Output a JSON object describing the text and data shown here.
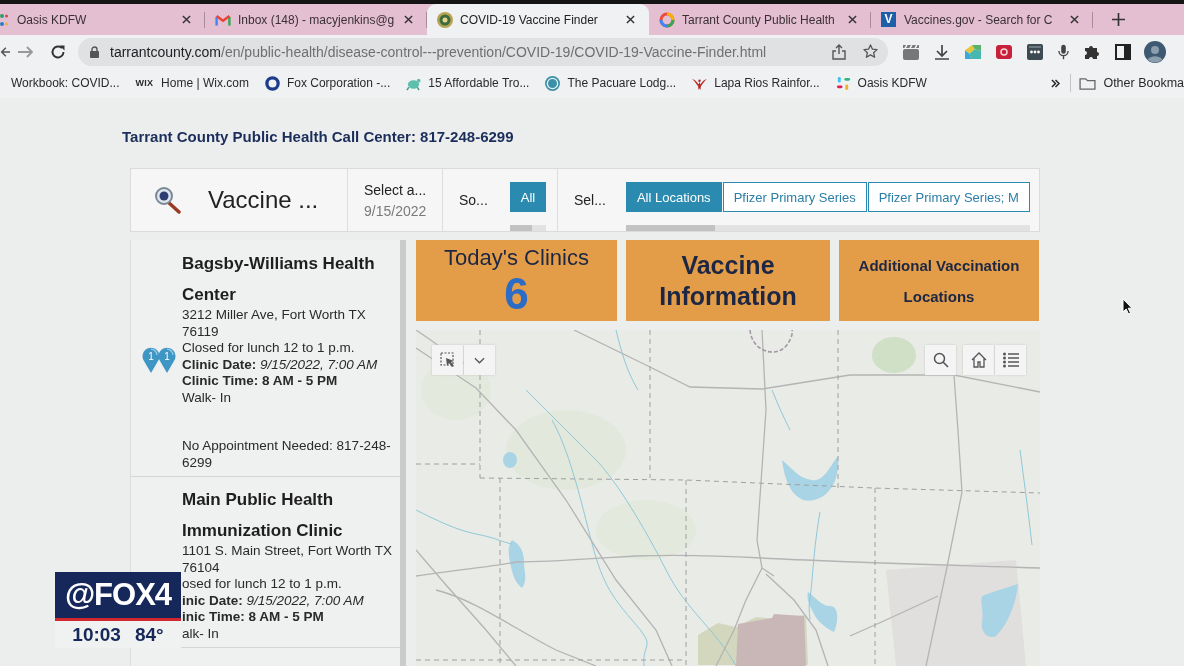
{
  "browser": {
    "tabs": [
      {
        "title": "Oasis KDFW",
        "selected": false
      },
      {
        "title": "Inbox (148) - macyjenkins@g",
        "selected": false
      },
      {
        "title": "COVID-19 Vaccine Finder",
        "selected": true
      },
      {
        "title": "Tarrant County Public Health",
        "selected": false
      },
      {
        "title": "Vaccines.gov - Search for C",
        "favicon_letter": "V",
        "selected": false
      }
    ],
    "address_bar": {
      "host": "tarrantcounty.com",
      "path": "/en/public-health/disease-control---prevention/COVID-19/COVID-19-Vaccine-Finder.html"
    },
    "bookmarks": [
      {
        "title": "Workbook: COVID..."
      },
      {
        "title": "Home | Wix.com",
        "icon_text": "WIX"
      },
      {
        "title": "Fox Corporation -..."
      },
      {
        "title": "15 Affordable Tro..."
      },
      {
        "title": "The Pacuare Lodg..."
      },
      {
        "title": "Lapa Rios Rainfor..."
      },
      {
        "title": "Oasis KDFW"
      }
    ],
    "other_bookmarks": "Other Bookma"
  },
  "page": {
    "call_center": "Tarrant County Public Health Call Center: 817-248-6299",
    "toolbar": {
      "title": "Vaccine ...",
      "date_select": {
        "label": "Select a...",
        "value": "9/15/2022"
      },
      "sort": {
        "label": "So...",
        "options": [
          {
            "label": "All",
            "selected": true
          }
        ]
      },
      "location_filter": {
        "label": "Sel...",
        "options": [
          {
            "label": "All Locations",
            "selected": true
          },
          {
            "label": "Pfizer Primary Series",
            "selected": false
          },
          {
            "label": "Pfizer Primary Series; M",
            "selected": false
          }
        ]
      }
    },
    "clinics": [
      {
        "name": "Bagsby-Williams Health Center",
        "pins": [
          "1",
          "1"
        ],
        "lines": [
          {
            "kind": "plain",
            "text": "3212 Miller Ave, Fort Worth TX 76119"
          },
          {
            "kind": "plain",
            "text": "Closed for lunch 12 to 1 p.m."
          },
          {
            "kind": "plain",
            "text": "**Clinic Date:** *9/15/2022, 7:00 AM*"
          },
          {
            "kind": "bold",
            "text": "Clinic Time: 8 AM - 5 PM"
          },
          {
            "kind": "plain",
            "text": "Walk- In"
          },
          {
            "kind": "note",
            "text": "No Appointment Needed: 817-248-6299"
          }
        ]
      },
      {
        "name": "Main Public Health Immunization Clinic",
        "lines": [
          {
            "kind": "plain",
            "text": "1101 S. Main Street, Fort Worth TX 76104"
          },
          {
            "kind": "plain",
            "text": "osed for lunch 12 to 1 p.m."
          },
          {
            "kind": "plain",
            "text": "**inic Date:** *9/15/2022, 7:00 AM*"
          },
          {
            "kind": "bold",
            "text": "inic Time: 8 AM - 5 PM"
          },
          {
            "kind": "plain",
            "text": "alk- In"
          }
        ]
      }
    ],
    "tiles": [
      {
        "kind": "count",
        "title": "Today's Clinics",
        "value": "6"
      },
      {
        "kind": "heading",
        "title": "Vaccine Information"
      },
      {
        "kind": "link",
        "title": "Additional Vaccination Locations"
      }
    ]
  },
  "broadcast_overlay": {
    "logo": "@FOX4",
    "time": "10:03",
    "temperature": "84°"
  }
}
